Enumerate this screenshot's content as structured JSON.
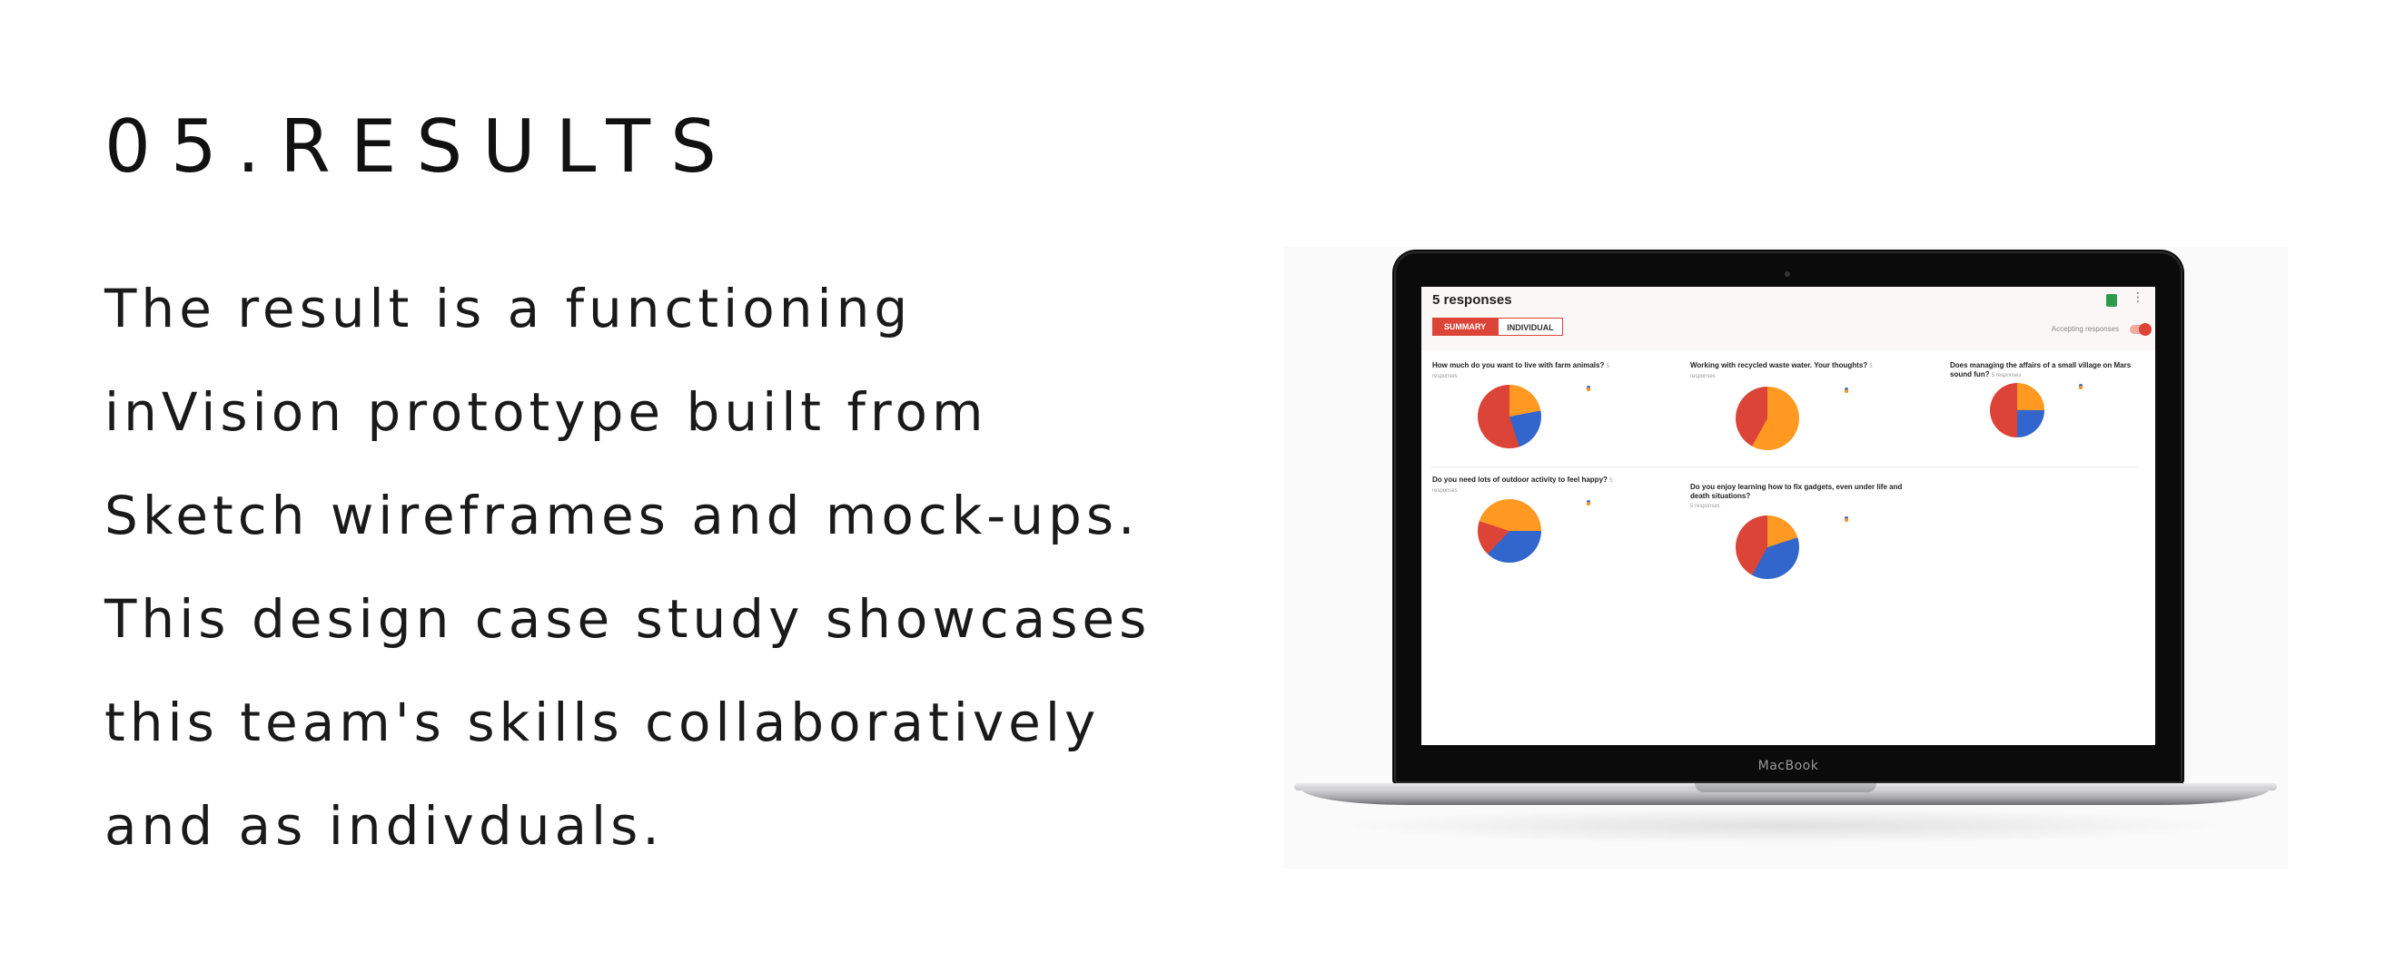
{
  "heading": "05.RESULTS",
  "paragraph_lines": [
    "The result is a functioning",
    "inVision prototype built from",
    "Sketch wireframes and mock-ups.",
    "This design case study showcases",
    "this team's skills collaboratively",
    "and as indivduals."
  ],
  "laptop": {
    "brand": "MacBook",
    "screen": {
      "responses": "5 responses",
      "tabs": [
        "SUMMARY",
        "INDIVIDUAL"
      ],
      "accepting_label": "Accepting responses",
      "icons": [
        "sheets-icon",
        "more-vertical-icon"
      ],
      "colors": {
        "red": "#db4437",
        "orange": "#ff9922",
        "blue": "#3366cc"
      },
      "questions": [
        {
          "title": "How much do you want to live with farm animals?",
          "sub": "5 responses"
        },
        {
          "title": "Working with recycled waste water. Your thoughts?",
          "sub": "5 responses"
        },
        {
          "title": "Does managing the affairs of a small village on Mars sound fun?",
          "sub": "5 responses"
        },
        {
          "title": "Do you need lots of outdoor activity to feel happy?",
          "sub": "5 responses"
        },
        {
          "title": "Do you enjoy learning how to fix gadgets, even under life and death situations?",
          "sub": "5 responses"
        }
      ]
    }
  }
}
